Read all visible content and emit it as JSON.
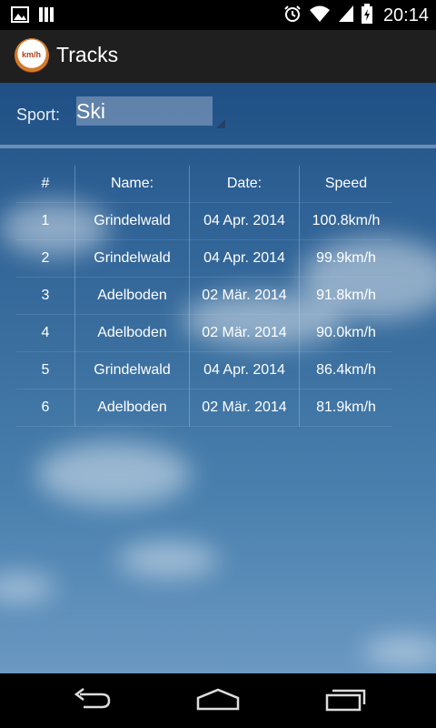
{
  "status_bar": {
    "time": "20:14"
  },
  "action_bar": {
    "title": "Tracks",
    "logo_text": "km/h"
  },
  "sport": {
    "label": "Sport:",
    "value": "Ski"
  },
  "table": {
    "headers": [
      "#",
      "Name:",
      "Date:",
      "Speed"
    ],
    "rows": [
      [
        "1",
        "Grindelwald",
        "04 Apr. 2014",
        "100.8km/h"
      ],
      [
        "2",
        "Grindelwald",
        "04 Apr. 2014",
        "99.9km/h"
      ],
      [
        "3",
        "Adelboden",
        "02 Mär. 2014",
        "91.8km/h"
      ],
      [
        "4",
        "Adelboden",
        "02 Mär. 2014",
        "90.0km/h"
      ],
      [
        "5",
        "Grindelwald",
        "04 Apr. 2014",
        "86.4km/h"
      ],
      [
        "6",
        "Adelboden",
        "02 Mär. 2014",
        "81.9km/h"
      ]
    ]
  },
  "icons": {
    "status_left": [
      "image-icon",
      "storage-icon"
    ],
    "status_right": [
      "alarm-icon",
      "wifi-icon",
      "signal-icon",
      "battery-icon"
    ],
    "nav": [
      "back-icon",
      "home-icon",
      "recent-apps-icon"
    ]
  }
}
